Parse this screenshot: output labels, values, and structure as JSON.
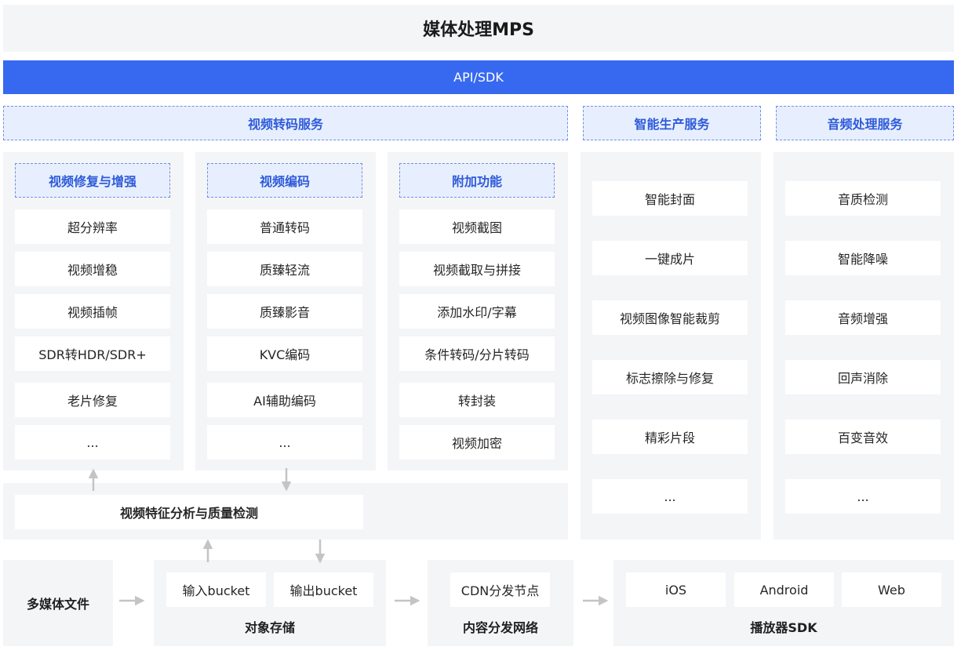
{
  "header": {
    "title": "媒体处理MPS"
  },
  "api": {
    "label": "API/SDK"
  },
  "services": {
    "video_transcode": {
      "title": "视频转码服务",
      "repair": {
        "title": "视频修复与增强",
        "items": [
          "超分辨率",
          "视频增稳",
          "视频插帧",
          "SDR转HDR/SDR+",
          "老片修复",
          "..."
        ]
      },
      "encode": {
        "title": "视频编码",
        "items": [
          "普通转码",
          "质臻轻流",
          "质臻影音",
          "KVC编码",
          "AI辅助编码",
          "..."
        ]
      },
      "extra": {
        "title": "附加功能",
        "items": [
          "视频截图",
          "视频截取与拼接",
          "添加水印/字幕",
          "条件转码/分片转码",
          "转封装",
          "视频加密"
        ]
      },
      "analysis": "视频特征分析与质量检测"
    },
    "smart_production": {
      "title": "智能生产服务",
      "items": [
        "智能封面",
        "一键成片",
        "视频图像智能裁剪",
        "标志擦除与修复",
        "精彩片段",
        "..."
      ]
    },
    "audio": {
      "title": "音频处理服务",
      "items": [
        "音质检测",
        "智能降噪",
        "音频增强",
        "回声消除",
        "百变音效",
        "..."
      ]
    }
  },
  "pipeline": {
    "source": "多媒体文件",
    "storage": {
      "title": "对象存储",
      "input": "输入bucket",
      "output": "输出bucket"
    },
    "cdn": {
      "title": "内容分发网络",
      "node": "CDN分发节点"
    },
    "player": {
      "title": "播放器SDK",
      "items": [
        "iOS",
        "Android",
        "Web"
      ]
    }
  },
  "colors": {
    "accent": "#3769f0",
    "panel": "#f4f5f7",
    "dashed_border": "#6e8fe6",
    "head_text": "#2f5bd8",
    "arrow": "#c4c4c4"
  }
}
